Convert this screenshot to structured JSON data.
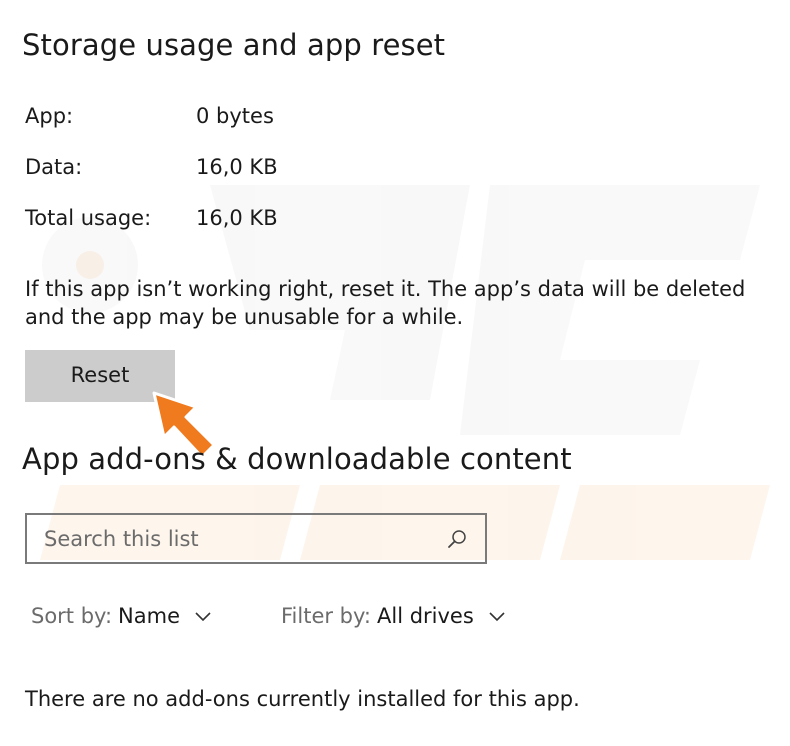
{
  "storage": {
    "title": "Storage usage and app reset",
    "rows": [
      {
        "label": "App:",
        "value": "0 bytes"
      },
      {
        "label": "Data:",
        "value": "16,0 KB"
      },
      {
        "label": "Total usage:",
        "value": "16,0 KB"
      }
    ],
    "reset_description_line1": "If this app isn’t working right, reset it. The app’s data will be deleted",
    "reset_description_line2": "and the app may be unusable for a while.",
    "reset_button": "Reset"
  },
  "addons": {
    "title": "App add-ons & downloadable content",
    "search_placeholder": "Search this list",
    "sort_label": "Sort by:",
    "sort_value": "Name",
    "filter_label": "Filter by:",
    "filter_value": "All drives",
    "empty_message": "There are no add-ons currently installed for this app."
  },
  "icons": {
    "search": "search-icon",
    "sort_chevron": "chevron-down-icon",
    "filter_chevron": "chevron-down-icon",
    "pointer": "arrow-pointer-icon"
  },
  "colors": {
    "button_bg": "#cccccc",
    "search_border": "#7a7a7a",
    "arrow_fill": "#f07a1e",
    "muted_text": "#6b6b6b"
  }
}
